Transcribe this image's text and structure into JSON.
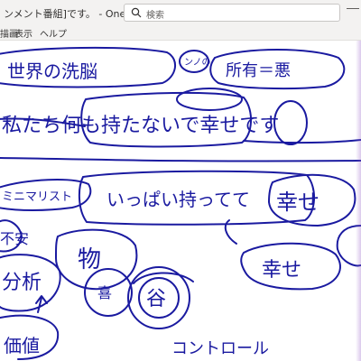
{
  "window": {
    "title": "ンメント番組]です。 - OneNote",
    "search_placeholder": "検索"
  },
  "menu": {
    "items": [
      "描画",
      "表示",
      "ヘルプ"
    ]
  },
  "canvas": {
    "ink_color": "#1a1aa0",
    "handwriting": {
      "line1": "世界の洗脳",
      "note_top_small": "ンノの",
      "note_top_right": "所有＝悪",
      "line2": "私たち何も持たないで幸せです",
      "word_left": "ミニマリスト",
      "phrase_mid": "いっぱい持ってて",
      "word_happy_box": "幸せ",
      "left_col_1": "不安",
      "left_col_2": "分析",
      "left_col_3": "価値",
      "word_mid_left": "物",
      "word_happy": "幸せ",
      "circle_a": "喜",
      "circle_b": "谷",
      "bottom_word": "コントロール"
    }
  }
}
